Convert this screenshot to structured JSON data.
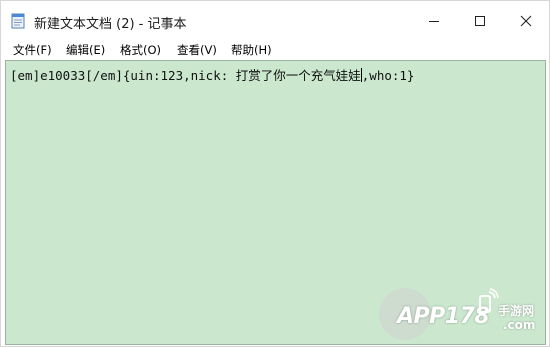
{
  "window": {
    "title": "新建文本文档 (2) - 记事本"
  },
  "menu": {
    "items": [
      {
        "label": "文件(F)"
      },
      {
        "label": "编辑(E)"
      },
      {
        "label": "格式(O)"
      },
      {
        "label": "查看(V)"
      },
      {
        "label": "帮助(H)"
      }
    ]
  },
  "editor": {
    "text_before_caret": "[em]e10033[/em]{uin:123,nick: 打赏了你一个充气娃娃",
    "text_after_caret": ",who:1}",
    "background": "#cbe8cf"
  },
  "watermark": {
    "brand": "APP178",
    "cn_text": "手游网",
    "domain": ".com"
  },
  "icons": {
    "app": "notepad-icon",
    "minimize": "minimize-icon",
    "maximize": "maximize-icon",
    "close": "close-icon"
  }
}
